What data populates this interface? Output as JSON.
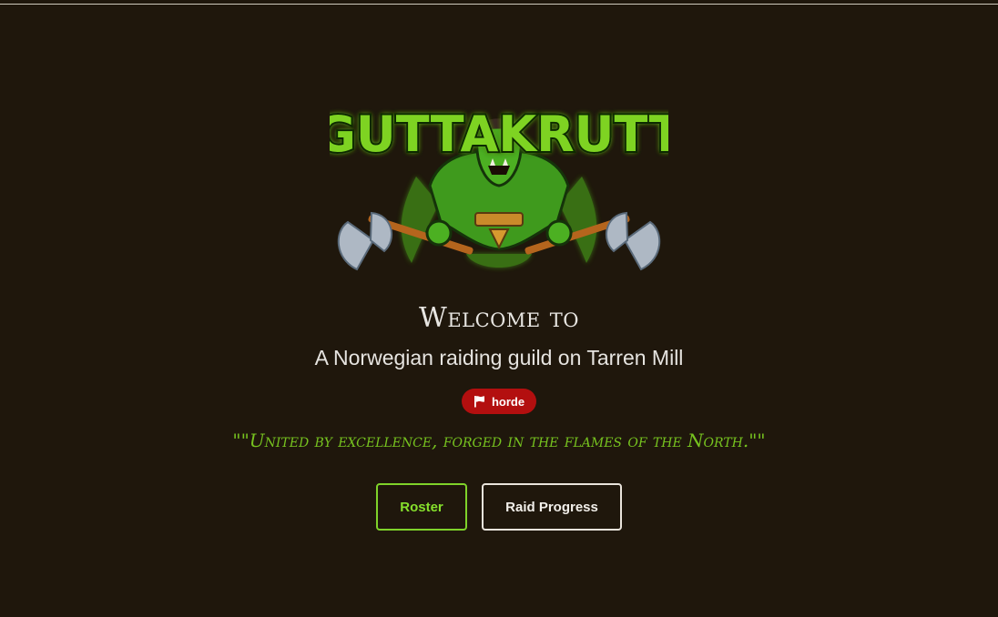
{
  "logo": {
    "text": "GUTTAKRUTT",
    "icon": "orc-warrior-with-axes-logo"
  },
  "hero": {
    "welcome": "Welcome to",
    "subtitle": "A Norwegian raiding guild on Tarren Mill",
    "faction_badge": {
      "label": "horde",
      "icon": "flag-icon",
      "color": "#b30f0f"
    },
    "motto": "\"\"United by excellence, forged in the flames of the North.\"\""
  },
  "buttons": {
    "roster_label": "Roster",
    "raid_progress_label": "Raid Progress"
  },
  "colors": {
    "background": "#1f170c",
    "accent_green": "#7fd32a",
    "motto_green": "#76c21f",
    "horde_red": "#b30f0f"
  }
}
